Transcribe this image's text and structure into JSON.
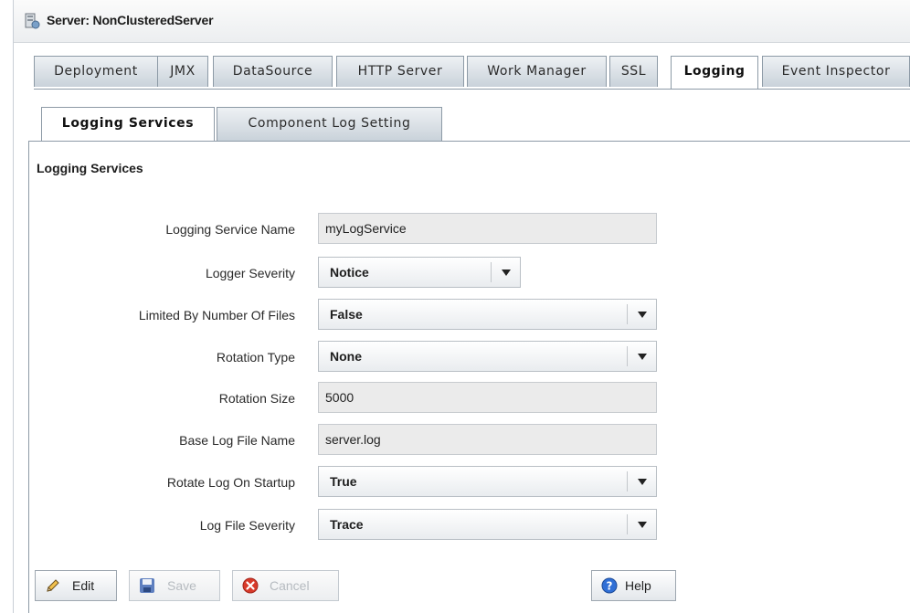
{
  "header": {
    "title": "Server: NonClusteredServer",
    "icon": "server-icon"
  },
  "main_tabs": [
    {
      "label": "Deployment"
    },
    {
      "label": "JMX"
    },
    {
      "label": "DataSource"
    },
    {
      "label": "HTTP Server"
    },
    {
      "label": "Work Manager"
    },
    {
      "label": "SSL"
    },
    {
      "label": "Logging",
      "active": true
    },
    {
      "label": "Event Inspector"
    }
  ],
  "sub_tabs": [
    {
      "label": "Logging Services",
      "active": true
    },
    {
      "label": "Component Log Setting"
    }
  ],
  "section": {
    "title": "Logging Services"
  },
  "form": {
    "logging_service_name": {
      "label": "Logging Service Name",
      "value": "myLogService"
    },
    "logger_severity": {
      "label": "Logger Severity",
      "value": "Notice"
    },
    "limited_by_number_of_files": {
      "label": "Limited By Number Of Files",
      "value": "False"
    },
    "rotation_type": {
      "label": "Rotation Type",
      "value": "None"
    },
    "rotation_size": {
      "label": "Rotation Size",
      "value": "5000"
    },
    "base_log_file_name": {
      "label": "Base Log File Name",
      "value": "server.log"
    },
    "rotate_log_on_startup": {
      "label": "Rotate Log On Startup",
      "value": "True"
    },
    "log_file_severity": {
      "label": "Log File Severity",
      "value": "Trace"
    }
  },
  "buttons": {
    "edit": {
      "label": "Edit",
      "icon": "pencil-icon",
      "enabled": true
    },
    "save": {
      "label": "Save",
      "icon": "floppy-disk-icon",
      "enabled": false
    },
    "cancel": {
      "label": "Cancel",
      "icon": "cancel-icon",
      "enabled": false
    },
    "help": {
      "label": "Help",
      "icon": "help-icon",
      "enabled": true
    }
  },
  "colors": {
    "tab_border": "#8d9aa6",
    "tab_fill": "#c9d2da",
    "field_readonly_bg": "#ebebeb",
    "help_blue": "#2f6fd6",
    "cancel_red": "#d83a2a",
    "save_blue": "#3a64b8"
  }
}
